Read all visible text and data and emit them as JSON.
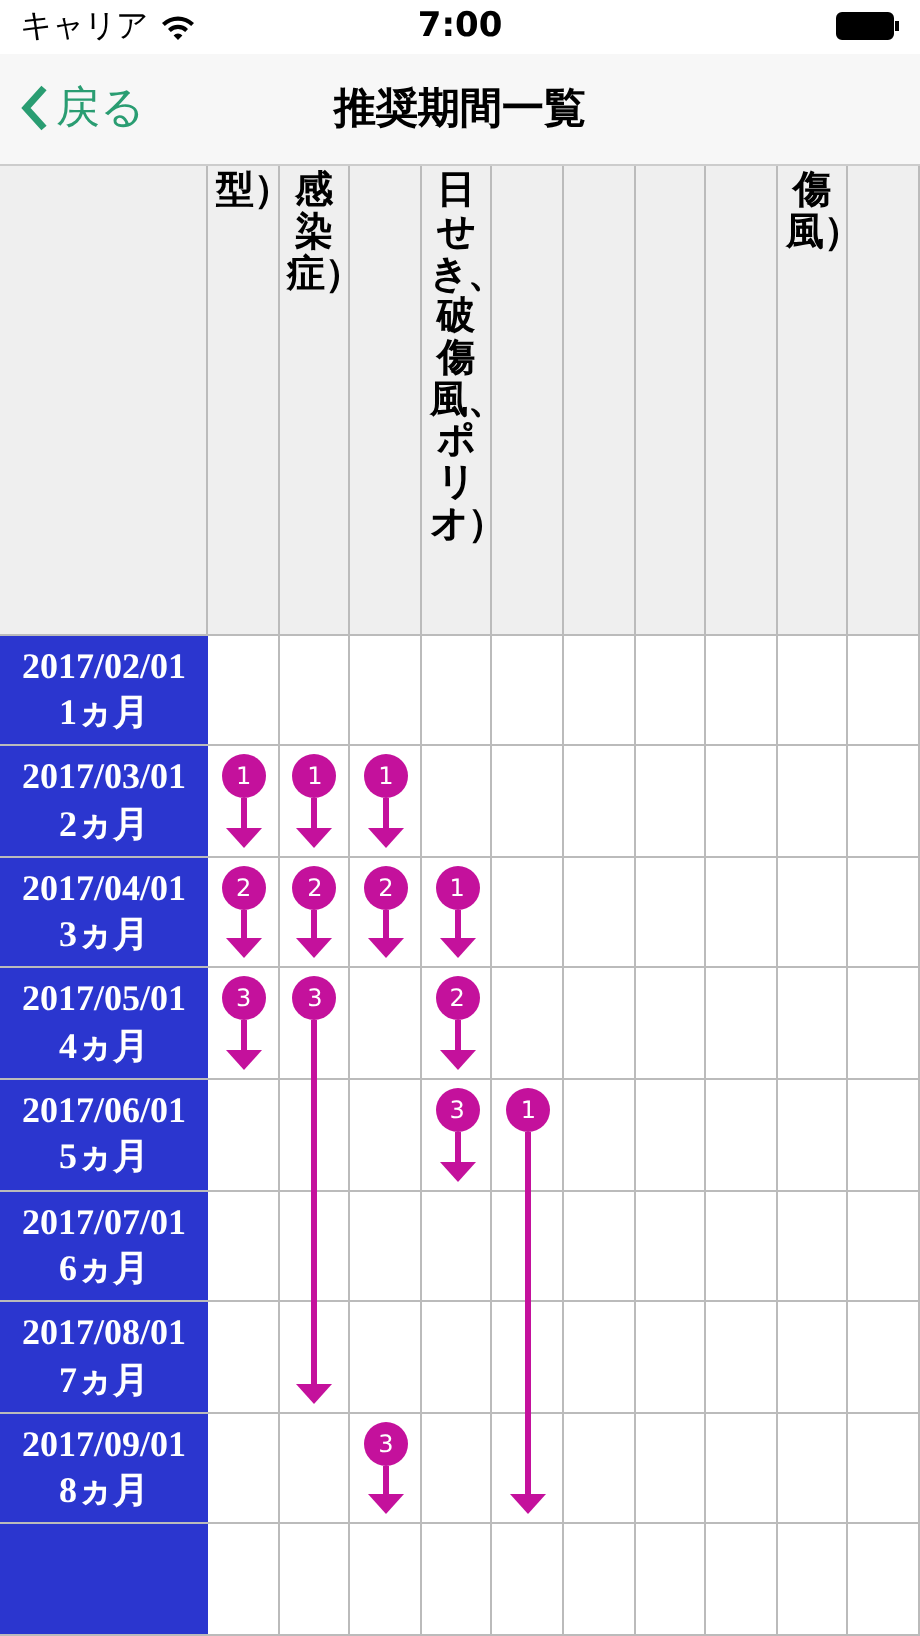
{
  "status_bar": {
    "carrier": "キャリア",
    "time": "7:00"
  },
  "nav": {
    "back": "戻る",
    "title": "推奨期間一覧"
  },
  "columns": [
    {
      "label": "型）"
    },
    {
      "label": "感染症）"
    },
    {},
    {
      "label": "日せき、破傷風、ポリオ）"
    },
    {},
    {},
    {},
    {},
    {
      "label": "傷風）"
    },
    {}
  ],
  "rows": [
    {
      "date": "2017/02/01",
      "age": "1ヵ月",
      "cells": [
        {
          "kind": "empty"
        },
        {
          "kind": "empty"
        },
        {
          "kind": "empty"
        },
        {
          "kind": "empty"
        },
        {
          "kind": "empty"
        },
        {
          "kind": "empty"
        },
        {
          "kind": "empty"
        },
        {
          "kind": "empty"
        },
        {
          "kind": "empty"
        },
        {
          "kind": "empty"
        }
      ]
    },
    {
      "date": "2017/03/01",
      "age": "2ヵ月",
      "cells": [
        {
          "kind": "dose",
          "number": "1"
        },
        {
          "kind": "dose",
          "number": "1"
        },
        {
          "kind": "dose",
          "number": "1"
        },
        {
          "kind": "empty"
        },
        {
          "kind": "empty"
        },
        {
          "kind": "empty"
        },
        {
          "kind": "empty"
        },
        {
          "kind": "empty"
        },
        {
          "kind": "empty"
        },
        {
          "kind": "empty"
        }
      ]
    },
    {
      "date": "2017/04/01",
      "age": "3ヵ月",
      "cells": [
        {
          "kind": "dose",
          "number": "2"
        },
        {
          "kind": "dose",
          "number": "2"
        },
        {
          "kind": "dose",
          "number": "2"
        },
        {
          "kind": "dose",
          "number": "1"
        },
        {
          "kind": "empty"
        },
        {
          "kind": "empty"
        },
        {
          "kind": "empty"
        },
        {
          "kind": "empty"
        },
        {
          "kind": "empty"
        },
        {
          "kind": "empty"
        }
      ]
    },
    {
      "date": "2017/05/01",
      "age": "4ヵ月",
      "cells": [
        {
          "kind": "dose",
          "number": "3"
        },
        {
          "kind": "dose_start",
          "number": "3"
        },
        {
          "kind": "empty"
        },
        {
          "kind": "dose",
          "number": "2"
        },
        {
          "kind": "empty"
        },
        {
          "kind": "empty"
        },
        {
          "kind": "empty"
        },
        {
          "kind": "empty"
        },
        {
          "kind": "empty"
        },
        {
          "kind": "empty"
        }
      ]
    },
    {
      "date": "2017/06/01",
      "age": "5ヵ月",
      "cells": [
        {
          "kind": "empty"
        },
        {
          "kind": "through"
        },
        {
          "kind": "empty"
        },
        {
          "kind": "dose",
          "number": "3"
        },
        {
          "kind": "dose_start",
          "number": "1"
        },
        {
          "kind": "empty"
        },
        {
          "kind": "empty"
        },
        {
          "kind": "empty"
        },
        {
          "kind": "empty"
        },
        {
          "kind": "empty"
        }
      ]
    },
    {
      "date": "2017/07/01",
      "age": "6ヵ月",
      "cells": [
        {
          "kind": "empty"
        },
        {
          "kind": "through"
        },
        {
          "kind": "empty"
        },
        {
          "kind": "empty"
        },
        {
          "kind": "through"
        },
        {
          "kind": "empty"
        },
        {
          "kind": "empty"
        },
        {
          "kind": "empty"
        },
        {
          "kind": "empty"
        },
        {
          "kind": "empty"
        }
      ]
    },
    {
      "date": "2017/08/01",
      "age": "7ヵ月",
      "cells": [
        {
          "kind": "empty"
        },
        {
          "kind": "end"
        },
        {
          "kind": "empty"
        },
        {
          "kind": "empty"
        },
        {
          "kind": "through"
        },
        {
          "kind": "empty"
        },
        {
          "kind": "empty"
        },
        {
          "kind": "empty"
        },
        {
          "kind": "empty"
        },
        {
          "kind": "empty"
        }
      ]
    },
    {
      "date": "2017/09/01",
      "age": "8ヵ月",
      "cells": [
        {
          "kind": "empty"
        },
        {
          "kind": "empty"
        },
        {
          "kind": "dose",
          "number": "3"
        },
        {
          "kind": "empty"
        },
        {
          "kind": "end"
        },
        {
          "kind": "empty"
        },
        {
          "kind": "empty"
        },
        {
          "kind": "empty"
        },
        {
          "kind": "empty"
        },
        {
          "kind": "empty"
        }
      ]
    }
  ]
}
